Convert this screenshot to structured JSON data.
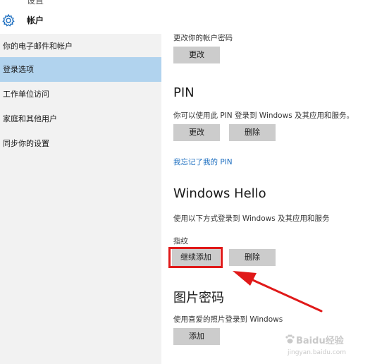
{
  "window": {
    "top_cut_title": "设置",
    "title": "帐户"
  },
  "sidebar": {
    "items": [
      {
        "label": "你的电子邮件和帐户"
      },
      {
        "label": "登录选项"
      },
      {
        "label": "工作单位访问"
      },
      {
        "label": "家庭和其他用户"
      },
      {
        "label": "同步你的设置"
      }
    ],
    "active_index": 1
  },
  "password": {
    "description": "更改你的帐户密码",
    "change_button": "更改"
  },
  "pin": {
    "heading": "PIN",
    "description": "你可以使用此 PIN 登录到 Windows 及其应用和服务。",
    "change_button": "更改",
    "delete_button": "删除",
    "forgot_link": "我忘记了我的 PIN"
  },
  "hello": {
    "heading": "Windows Hello",
    "description": "使用以下方式登录到 Windows 及其应用和服务",
    "fingerprint_label": "指纹",
    "continue_add_button": "继续添加",
    "delete_button": "删除"
  },
  "picture_password": {
    "heading": "图片密码",
    "description": "使用喜爱的照片登录到 Windows",
    "add_button": "添加"
  },
  "watermark": {
    "text": "Baidu经验",
    "url": "jingyan.baidu.com"
  },
  "colors": {
    "sidebar_bg": "#f2f2f2",
    "sidebar_active": "#b1d3ee",
    "button_bg": "#cccccc",
    "link": "#1e6fc0",
    "annotation_red": "#e01919"
  }
}
